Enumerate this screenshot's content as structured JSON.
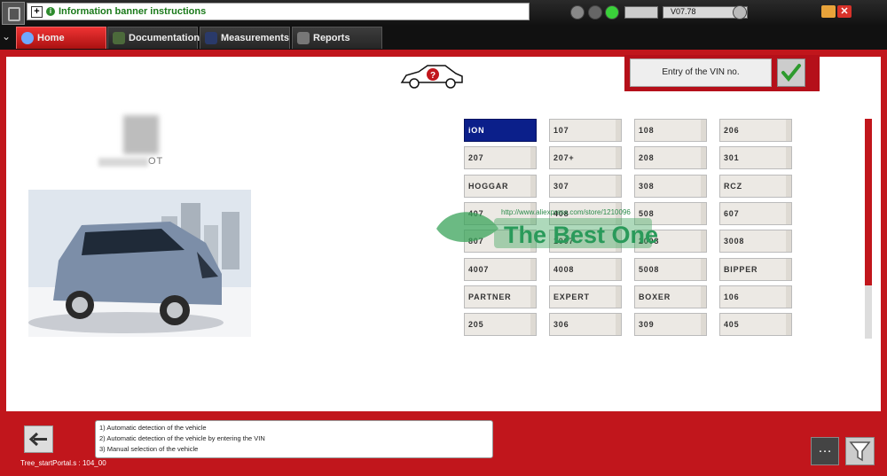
{
  "window": {
    "banner_text": "Information banner instructions",
    "version": "V07.78"
  },
  "tabs": [
    {
      "label": "Home",
      "icon": "home-icon",
      "active": true
    },
    {
      "label": "Documentation",
      "icon": "documentation-icon",
      "active": false
    },
    {
      "label": "Measurements",
      "icon": "measurements-icon",
      "active": false
    },
    {
      "label": "Reports",
      "icon": "reports-icon",
      "active": false
    }
  ],
  "vin": {
    "label": "Entry of the VIN no."
  },
  "brand": {
    "logo_text": "OT"
  },
  "models": [
    [
      "iON",
      "207",
      "HOGGAR",
      "407",
      "807",
      "4007",
      "PARTNER",
      "205"
    ],
    [
      "107",
      "207+",
      "307",
      "408",
      "1007",
      "4008",
      "EXPERT",
      "306"
    ],
    [
      "108",
      "208",
      "308",
      "508",
      "2008",
      "5008",
      "BOXER",
      "309"
    ],
    [
      "206",
      "301",
      "RCZ",
      "607",
      "3008",
      "BIPPER",
      "106",
      "405"
    ]
  ],
  "selected_model": "iON",
  "watermark": {
    "url": "http://www.aliexpress.com/store/1210096",
    "text": "The Best One"
  },
  "steps": [
    "1) Automatic detection of the vehicle",
    "2) Automatic detection of the vehicle by entering the VIN",
    "3) Manual selection of the vehicle"
  ],
  "status": "Tree_startPortal.s : 104_00",
  "colors": {
    "brand_red": "#c1161c",
    "selected_blue": "#0b1f8a",
    "banner_green": "#1a7a1a"
  }
}
